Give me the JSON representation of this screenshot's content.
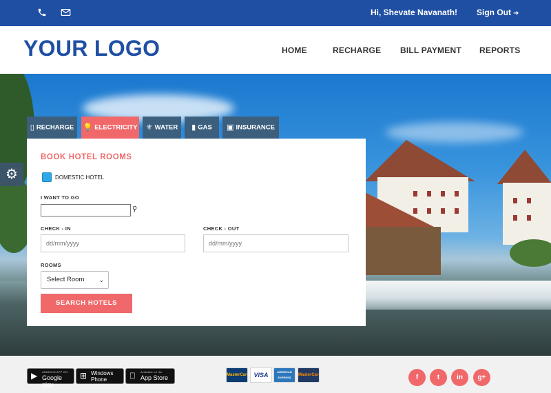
{
  "topbar": {
    "greeting": "Hi, Shevate Navanath!",
    "signout_label": "Sign Out",
    "icons": [
      "phone-icon",
      "mail-icon"
    ]
  },
  "header": {
    "logo": "YOUR LOGO",
    "nav": [
      "HOME",
      "RECHARGE",
      "BILL PAYMENT",
      "REPORTS"
    ]
  },
  "tabs": [
    {
      "label": "RECHARGE",
      "icon": "mobile-icon"
    },
    {
      "label": "ELECTRICITY",
      "icon": "bulb-icon",
      "active": true
    },
    {
      "label": "WATER",
      "icon": "tap-icon"
    },
    {
      "label": "GAS",
      "icon": "gas-cylinder-icon"
    },
    {
      "label": "INSURANCE",
      "icon": "money-icon"
    }
  ],
  "form": {
    "title": "BOOK HOTEL ROOMS",
    "checkbox_label": "DOMESTIC HOTEL",
    "destination_label": "I WANT TO GO",
    "destination_value": "",
    "checkin_label": "CHECK - IN",
    "checkin_placeholder": "dd/mm/yyyy",
    "checkout_label": "CHECK - OUT",
    "checkout_placeholder": "dd/mm/yyyy",
    "rooms_label": "ROOMS",
    "rooms_selected": "Select Room",
    "submit_label": "SEARCH HOTELS"
  },
  "footer": {
    "stores": [
      {
        "small": "ANDROID APP ON",
        "big": "Google play"
      },
      {
        "line1": "Windows",
        "line2": "Phone"
      },
      {
        "small": "Available on the",
        "big": "App Store"
      }
    ],
    "cards": [
      "MasterCard",
      "VISA",
      "AMERICAN EXPRESS",
      "MasterCard"
    ],
    "social": [
      "f",
      "t",
      "in",
      "g+"
    ]
  },
  "colors": {
    "primary": "#1f4fa3",
    "accent": "#f0686a",
    "tab": "#3c5f7e"
  }
}
